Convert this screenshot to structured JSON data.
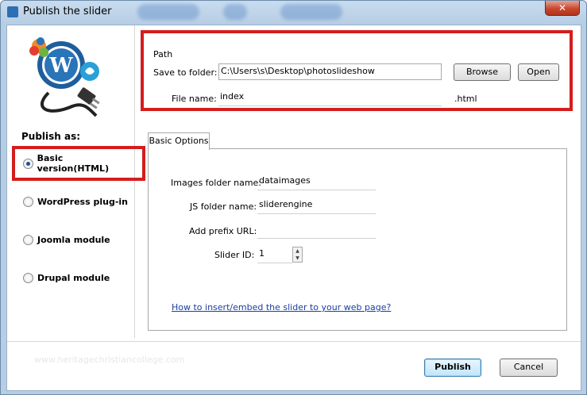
{
  "window": {
    "title": "Publish the slider",
    "close_glyph": "✕"
  },
  "left": {
    "publish_as_label": "Publish as:",
    "options": [
      {
        "label": "Basic version(HTML)",
        "checked": true
      },
      {
        "label": "WordPress plug-in",
        "checked": false
      },
      {
        "label": "Joomla module",
        "checked": false
      },
      {
        "label": "Drupal module",
        "checked": false
      }
    ]
  },
  "path": {
    "legend": "Path",
    "save_label": "Save to folder:",
    "save_value": "C:\\Users\\s\\Desktop\\photoslideshow",
    "browse_label": "Browse",
    "open_label": "Open",
    "file_label": "File name:",
    "file_value": "index",
    "extension": ".html"
  },
  "tabs": [
    {
      "label": "Basic Options",
      "active": true
    }
  ],
  "basic_options": {
    "images_label": "Images folder name:",
    "images_value": "dataimages",
    "js_label": "JS folder name:",
    "js_value": "sliderengine",
    "prefix_label": "Add prefix URL:",
    "prefix_value": "",
    "slider_id_label": "Slider ID:",
    "slider_id_value": "1",
    "help_link": "How to insert/embed the slider to your web page?"
  },
  "footer": {
    "publish_label": "Publish",
    "cancel_label": "Cancel",
    "watermark": "www.heritagechristiancollege.com"
  },
  "colors": {
    "highlight_red": "#d41d1d",
    "title_bar": "#b6cde4",
    "link_blue": "#1b3ea3"
  },
  "icons": [
    "app-icon",
    "slider-logo-icon",
    "close-icon",
    "spinner-up-icon",
    "spinner-down-icon"
  ]
}
